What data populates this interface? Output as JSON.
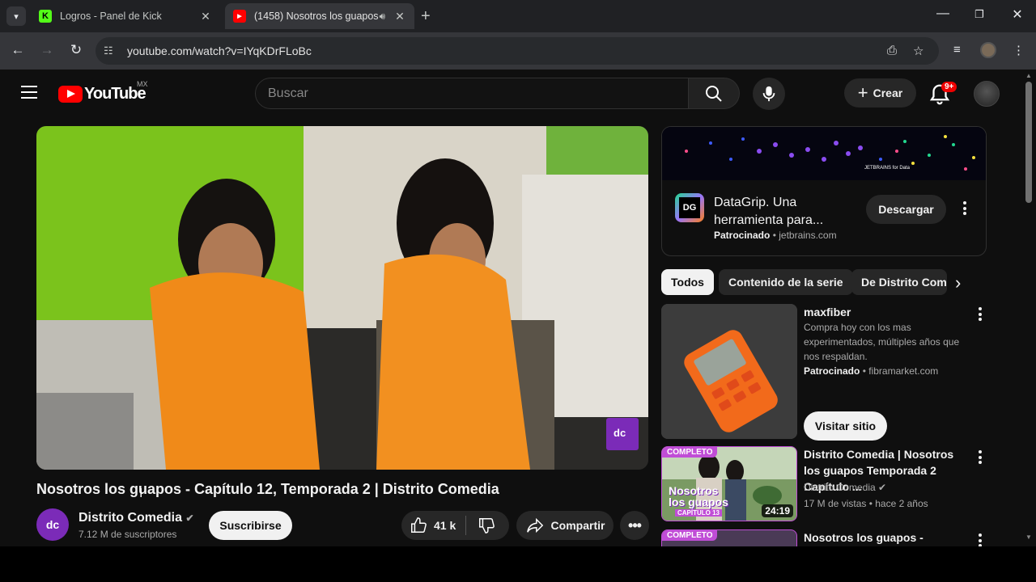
{
  "browser": {
    "tabs": [
      {
        "title": "Logros - Panel de Kick",
        "favicon": "K",
        "favicon_color": "#53fc18",
        "active": false
      },
      {
        "title": "(1458) Nosotros los guapos",
        "favicon": "▶",
        "favicon_color": "#ff0000",
        "active": true,
        "audio_icon": "speaker-icon"
      }
    ],
    "url": "youtube.com/watch?v=IYqKDrFLoBc"
  },
  "youtube": {
    "logo_text": "YouTube",
    "country_code": "MX",
    "search_placeholder": "Buscar",
    "create_label": "Crear",
    "notifications_badge": "9+"
  },
  "video": {
    "title": "Nosotros los guapos - Capítulo 12, Temporada 2 | Distrito Comedia",
    "channel_avatar": "dc",
    "channel_name": "Distrito Comedia",
    "subscribers": "7.12 M de suscriptores",
    "subscribe_label": "Suscribirse",
    "likes": "41 k",
    "share_label": "Compartir",
    "watermark": "dc"
  },
  "ad": {
    "logo": "DG",
    "title": "DataGrip. Una herramienta para...",
    "sponsored": "Patrocinado",
    "domain": "jetbrains.com",
    "cta": "Descargar",
    "banner_text": "JETBRAINS for Data"
  },
  "chips": [
    "Todos",
    "Contenido de la serie",
    "De Distrito Comedia"
  ],
  "sidebar": [
    {
      "type": "ad",
      "title": "maxfiber",
      "description": "Compra hoy con los mas experimentados, múltiples años que nos respaldan.",
      "sponsored": "Patrocinado",
      "domain": "fibramarket.com",
      "cta": "Visitar sitio"
    },
    {
      "type": "video",
      "badge": "COMPLETO",
      "title": "Distrito Comedia | Nosotros los guapos Temporada 2 Capítulo ...",
      "channel": "Distrito Comedia",
      "meta": "17 M de vistas • hace 2 años",
      "duration": "24:19",
      "thumb_text_1": "Nosotros",
      "thumb_text_2": "los guapos",
      "thumb_text_3": "CAPÍTULO 13"
    },
    {
      "type": "video",
      "badge": "COMPLETO",
      "title": "Nosotros los guapos - Capítulo"
    }
  ],
  "colors": {
    "background": "#0f0f0f",
    "youtube_red": "#ff0000",
    "chip_active": "#f1f1f1",
    "complete_badge": "#c04dd6",
    "channel_purple": "#7b2bb8"
  }
}
